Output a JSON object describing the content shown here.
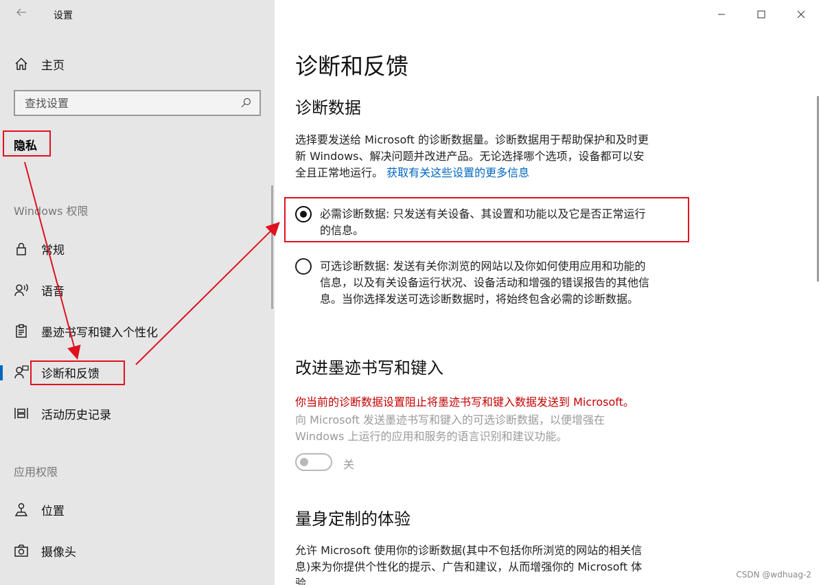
{
  "window": {
    "title": "设置"
  },
  "sidebar": {
    "home_label": "主页",
    "search_placeholder": "查找设置",
    "category_label": "隐私",
    "section_windows": "Windows 权限",
    "section_apps": "应用权限",
    "items": [
      {
        "label": "常规",
        "icon": "lock-icon"
      },
      {
        "label": "语音",
        "icon": "speech-icon"
      },
      {
        "label": "墨迹书写和键入个性化",
        "icon": "clipboard-icon"
      },
      {
        "label": "诊断和反馈",
        "icon": "feedback-icon",
        "active": true
      },
      {
        "label": "活动历史记录",
        "icon": "timeline-icon"
      },
      {
        "label": "位置",
        "icon": "location-icon"
      },
      {
        "label": "摄像头",
        "icon": "camera-icon"
      }
    ]
  },
  "main": {
    "title": "诊断和反馈",
    "diag_heading": "诊断数据",
    "diag_para_1": "选择要发送给 Microsoft 的诊断数据量。诊断数据用于帮助保护和及时更",
    "diag_para_2": "新 Windows、解决问题并改进产品。无论选择哪个选项，设备都可以安",
    "diag_para_3": "全且正常地运行。",
    "diag_link": "获取有关这些设置的更多信息",
    "radio_required_line1": "必需诊断数据: 只发送有关设备、其设置和功能以及它是否正常运行",
    "radio_required_line2": "的信息。",
    "radio_optional_line1": "可选诊断数据: 发送有关你浏览的网站以及你如何使用应用和功能的",
    "radio_optional_line2": "信息，以及有关设备运行状况、设备活动和增强的错误报告的其他信",
    "radio_optional_line3": "息。当你选择发送可选诊断数据时，将始终包含必需的诊断数据。",
    "ink_heading": "改进墨迹书写和键入",
    "ink_warning": "你当前的诊断数据设置阻止将墨迹书写和键入数据发送到 Microsoft。",
    "ink_desc_1": "向 Microsoft 发送墨迹书写和键入的可选诊断数据，以便增强在",
    "ink_desc_2": "Windows 上运行的应用和服务的语言识别和建议功能。",
    "ink_toggle_label": "关",
    "tailored_heading": "量身定制的体验",
    "tailored_para_1": "允许 Microsoft 使用你的诊断数据(其中不包括你所浏览的网站的相关信",
    "tailored_para_2": "息)来为你提供个性化的提示、广告和建议，从而增强你的 Microsoft 体",
    "tailored_para_3": "验"
  },
  "selected_option": "required",
  "ink_toggle_on": false,
  "watermark": "CSDN @wdhuag-2",
  "colors": {
    "accent": "#0067c0",
    "annotation": "#e0111e",
    "warning": "#c40000",
    "sidebar_bg": "#e6e6e6"
  }
}
